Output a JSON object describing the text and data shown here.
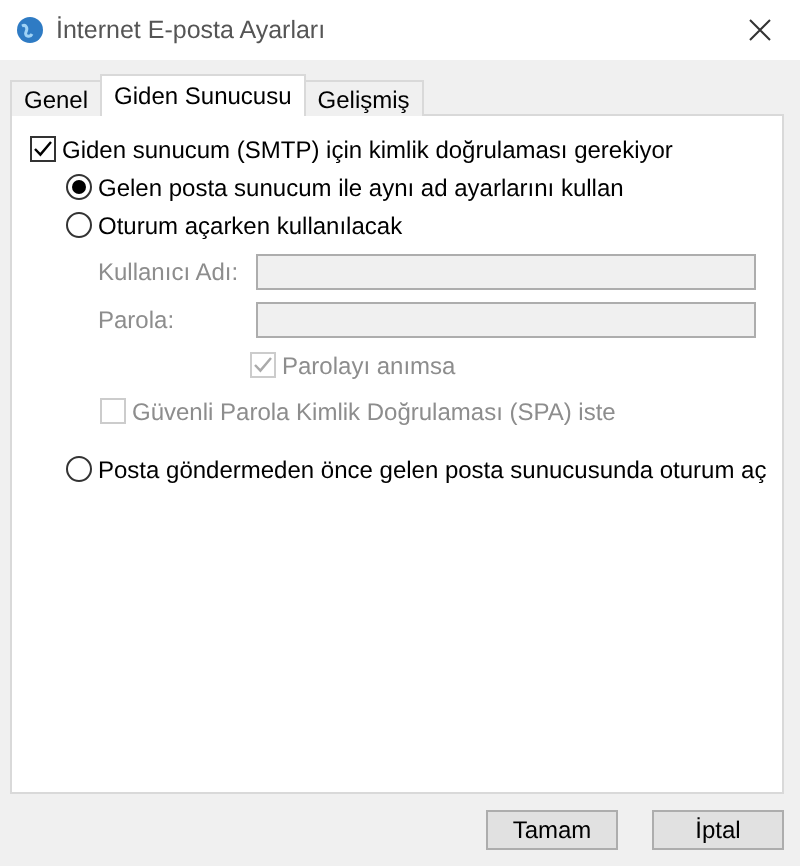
{
  "window": {
    "title": "İnternet E-posta Ayarları"
  },
  "tabs": [
    {
      "label": "Genel",
      "selected": false
    },
    {
      "label": "Giden Sunucusu",
      "selected": true
    },
    {
      "label": "Gelişmiş",
      "selected": false
    }
  ],
  "require_auth": {
    "label": "Giden sunucum (SMTP) için kimlik doğrulaması gerekiyor",
    "checked": true
  },
  "auth_methods": [
    {
      "label": "Gelen posta sunucum ile aynı ad ayarlarını kullan",
      "selected": true
    },
    {
      "label": "Oturum açarken kullanılacak",
      "selected": false,
      "details": {
        "fields": [
          {
            "label": "Kullanıcı Adı:",
            "disabled": true
          },
          {
            "label": "Parola:",
            "disabled": true
          }
        ],
        "remember_password": {
          "label": "Parolayı anımsa",
          "checked": true,
          "disabled": true
        },
        "spa": {
          "label": "Güvenli Parola Kimlik Doğrulaması (SPA) iste",
          "checked": false,
          "disabled": true
        }
      }
    },
    {
      "label": "Posta göndermeden önce gelen posta sunucusunda oturum aç",
      "selected": false
    }
  ],
  "buttons": [
    {
      "label": "Tamam"
    },
    {
      "label": "İptal"
    }
  ]
}
